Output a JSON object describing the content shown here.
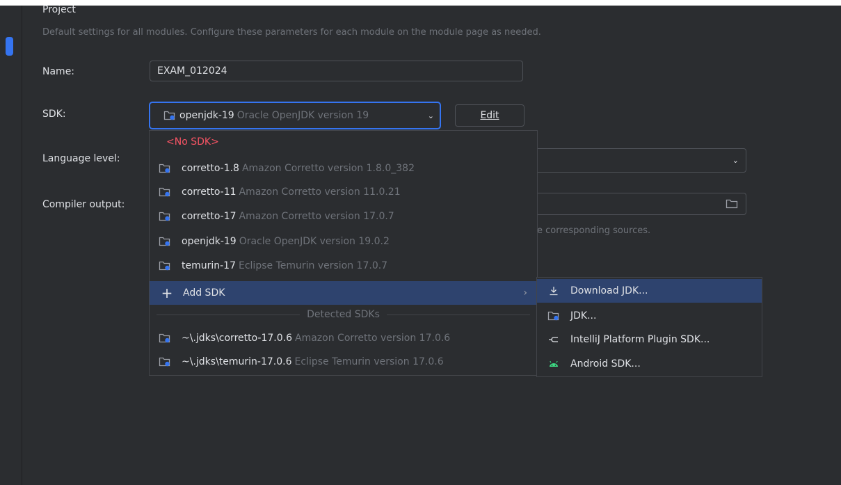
{
  "section": {
    "title": "Project",
    "description": "Default settings for all modules. Configure these parameters for each module on the module page as needed."
  },
  "fields": {
    "name_label": "Name:",
    "name_value": "EXAM_012024",
    "sdk_label": "SDK:",
    "sdk_selected_name": "openjdk-19",
    "sdk_selected_desc": "Oracle OpenJDK version 19",
    "edit_button": "Edit",
    "language_level_label": "Language level:",
    "compiler_output_label": "Compiler output:",
    "compiler_hint": "e corresponding sources."
  },
  "sdk_popup": {
    "no_sdk": "<No SDK>",
    "items": [
      {
        "name": "corretto-1.8",
        "desc": "Amazon Corretto version 1.8.0_382"
      },
      {
        "name": "corretto-11",
        "desc": "Amazon Corretto version 11.0.21"
      },
      {
        "name": "corretto-17",
        "desc": "Amazon Corretto version 17.0.7"
      },
      {
        "name": "openjdk-19",
        "desc": "Oracle OpenJDK version 19.0.2"
      },
      {
        "name": "temurin-17",
        "desc": "Eclipse Temurin version 17.0.7"
      }
    ],
    "add_sdk": "Add SDK",
    "detected_header": "Detected SDKs",
    "detected": [
      {
        "name": "~\\.jdks\\corretto-17.0.6",
        "desc": "Amazon Corretto version 17.0.6"
      },
      {
        "name": "~\\.jdks\\temurin-17.0.6",
        "desc": "Eclipse Temurin version 17.0.6"
      }
    ]
  },
  "add_sdk_submenu": {
    "items": [
      {
        "label": "Download JDK...",
        "icon": "download-icon"
      },
      {
        "label": "JDK...",
        "icon": "sdk-folder-icon"
      },
      {
        "label": "IntelliJ Platform Plugin SDK...",
        "icon": "plugin-icon"
      },
      {
        "label": "Android SDK...",
        "icon": "android-icon"
      }
    ]
  },
  "colors": {
    "accent": "#3574f0",
    "highlight": "#2e436e",
    "error_red": "#f75464",
    "android_green": "#3ddc84"
  }
}
